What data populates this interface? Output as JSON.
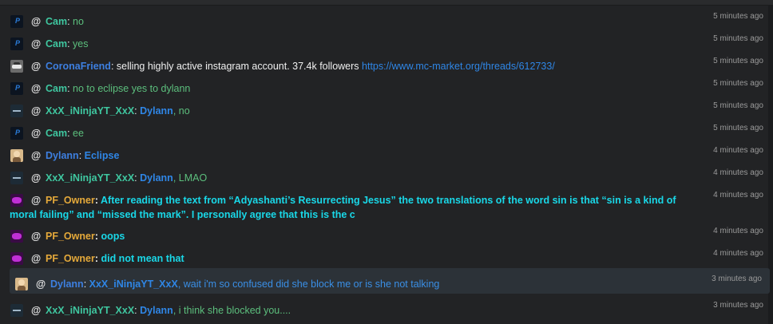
{
  "colors": {
    "background": "#222325",
    "highlight": "#2c3238",
    "timestamp": "#9a9a9a",
    "name_green": "#3fc7a0",
    "name_blue": "#3d7fe0",
    "name_gold": "#e5a93a",
    "text_cyan": "#19d8e8",
    "text_green": "#5cbf7d"
  },
  "mention_symbol": "@",
  "messages": [
    {
      "author": "Cam",
      "avatar_icon": "cam-avatar-icon",
      "sep": ": ",
      "text": "no",
      "time": "5 minutes ago"
    },
    {
      "author": "Cam",
      "avatar_icon": "cam-avatar-icon",
      "sep": ": ",
      "text": "yes",
      "time": "5 minutes ago"
    },
    {
      "author": "CoronaFriend",
      "avatar_icon": "car-avatar-icon",
      "sep": ": ",
      "text": "selling highly active instagram account. 37.4k followers ",
      "link": "https://www.mc-market.org/threads/612733/",
      "time": "5 minutes ago"
    },
    {
      "author": "Cam",
      "avatar_icon": "cam-avatar-icon",
      "sep": ": ",
      "text": "no to eclipse yes to dylann",
      "time": "5 minutes ago"
    },
    {
      "author": "XxX_iNinjaYT_XxX",
      "avatar_icon": "ninja-avatar-icon",
      "sep": ": ",
      "mention": "Dylann",
      "text": ", no",
      "time": "5 minutes ago"
    },
    {
      "author": "Cam",
      "avatar_icon": "cam-avatar-icon",
      "sep": ": ",
      "text": "ee",
      "time": "5 minutes ago"
    },
    {
      "author": "Dylann",
      "avatar_icon": "dylann-avatar-icon",
      "sep": ": ",
      "text": "Eclipse",
      "time": "4 minutes ago"
    },
    {
      "author": "XxX_iNinjaYT_XxX",
      "avatar_icon": "ninja-avatar-icon",
      "sep": ": ",
      "mention": "Dylann",
      "text": ", LMAO",
      "time": "4 minutes ago"
    },
    {
      "author": "PF_Owner",
      "avatar_icon": "pf-avatar-icon",
      "sep": ": ",
      "text_line1": "After reading the text from “Adyashanti’s Resurrecting Jesus” the two translations of the word sin is that “sin is a kind of",
      "text_line2": "moral failing” and “missed the mark”. I personally agree that this is the c",
      "time": "4 minutes ago"
    },
    {
      "author": "PF_Owner",
      "avatar_icon": "pf-avatar-icon",
      "sep": ": ",
      "text": "oops",
      "time": "4 minutes ago"
    },
    {
      "author": "PF_Owner",
      "avatar_icon": "pf-avatar-icon",
      "sep": ": ",
      "text": "did not mean that",
      "time": "4 minutes ago"
    },
    {
      "author": "Dylann",
      "avatar_icon": "dylann-avatar-icon",
      "sep": ": ",
      "mention": "XxX_iNinjaYT_XxX",
      "text": ", wait i'm so confused did she block me or is she not talking",
      "time": "3 minutes ago"
    },
    {
      "author": "XxX_iNinjaYT_XxX",
      "avatar_icon": "ninja-avatar-icon",
      "sep": ": ",
      "mention": "Dylann",
      "text": ", i think she blocked you....",
      "time": "3 minutes ago"
    }
  ]
}
